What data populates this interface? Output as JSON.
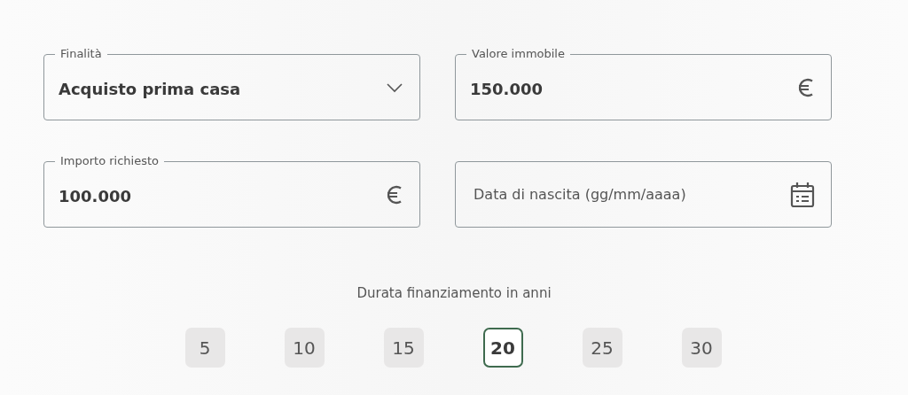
{
  "fields": [
    {
      "kind": "select",
      "label": "Finalità",
      "value": "Acquisto prima casa"
    },
    {
      "kind": "currency",
      "label": "Valore immobile",
      "value": "150.000"
    },
    {
      "kind": "currency",
      "label": "Importo richiesto",
      "value": "100.000"
    },
    {
      "kind": "date",
      "placeholder": "Data di nascita (gg/mm/aaaa)"
    }
  ],
  "duration": {
    "label": "Durata finanziamento in anni",
    "options": [
      {
        "label": "5",
        "selected": false
      },
      {
        "label": "10",
        "selected": false
      },
      {
        "label": "15",
        "selected": false
      },
      {
        "label": "20",
        "selected": true
      },
      {
        "label": "25",
        "selected": false
      },
      {
        "label": "30",
        "selected": false
      }
    ]
  }
}
